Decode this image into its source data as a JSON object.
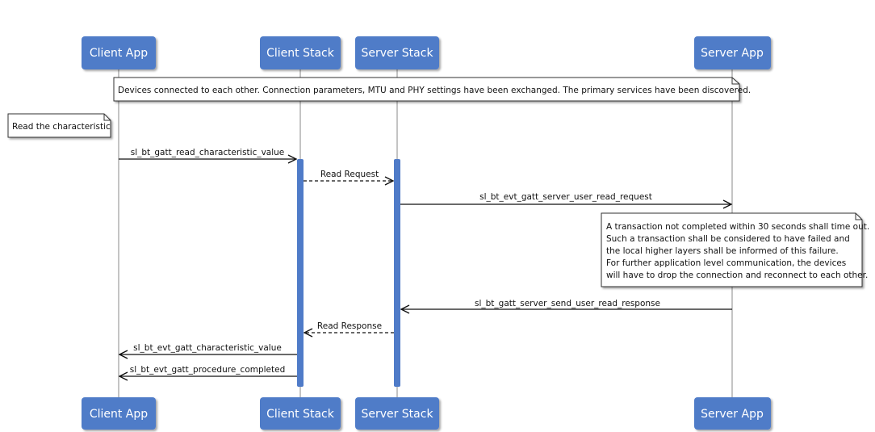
{
  "diagram": {
    "type": "sequence",
    "colors": {
      "participant_fill": "#4f7bc8",
      "participant_text": "#ffffff",
      "activation_fill": "#4f7bc8",
      "lifeline": "#888888",
      "arrow": "#111111",
      "note_fill": "#ffffff",
      "note_border": "#333333"
    },
    "participants": [
      {
        "id": "client_app",
        "label": "Client App"
      },
      {
        "id": "client_stack",
        "label": "Client Stack"
      },
      {
        "id": "server_stack",
        "label": "Server Stack"
      },
      {
        "id": "server_app",
        "label": "Server App"
      }
    ],
    "notes": [
      {
        "id": "setup",
        "text": [
          "Devices connected to each other. Connection parameters, MTU and PHY settings have been exchanged. The primary services have been discovered."
        ]
      },
      {
        "id": "read",
        "text": [
          "Read the characteristic"
        ]
      },
      {
        "id": "timeout",
        "text": [
          "A transaction not completed within 30 seconds shall time out.",
          "Such a transaction shall be considered to have failed and",
          "the local higher layers shall be informed of this failure.",
          "For further application level communication, the devices",
          "will have to drop the connection and reconnect to each other."
        ]
      }
    ],
    "messages": [
      {
        "from": "client_app",
        "to": "client_stack",
        "label": "sl_bt_gatt_read_characteristic_value",
        "style": "solid"
      },
      {
        "from": "client_stack",
        "to": "server_stack",
        "label": "Read Request",
        "style": "dashed"
      },
      {
        "from": "server_stack",
        "to": "server_app",
        "label": "sl_bt_evt_gatt_server_user_read_request",
        "style": "solid"
      },
      {
        "from": "server_app",
        "to": "server_stack",
        "label": "sl_bt_gatt_server_send_user_read_response",
        "style": "solid"
      },
      {
        "from": "server_stack",
        "to": "client_stack",
        "label": "Read Response",
        "style": "dashed"
      },
      {
        "from": "client_stack",
        "to": "client_app",
        "label": "sl_bt_evt_gatt_characteristic_value",
        "style": "solid"
      },
      {
        "from": "client_stack",
        "to": "client_app",
        "label": "sl_bt_evt_gatt_procedure_completed",
        "style": "solid"
      }
    ],
    "activations": [
      {
        "participant": "client_stack"
      },
      {
        "participant": "server_stack"
      }
    ]
  }
}
